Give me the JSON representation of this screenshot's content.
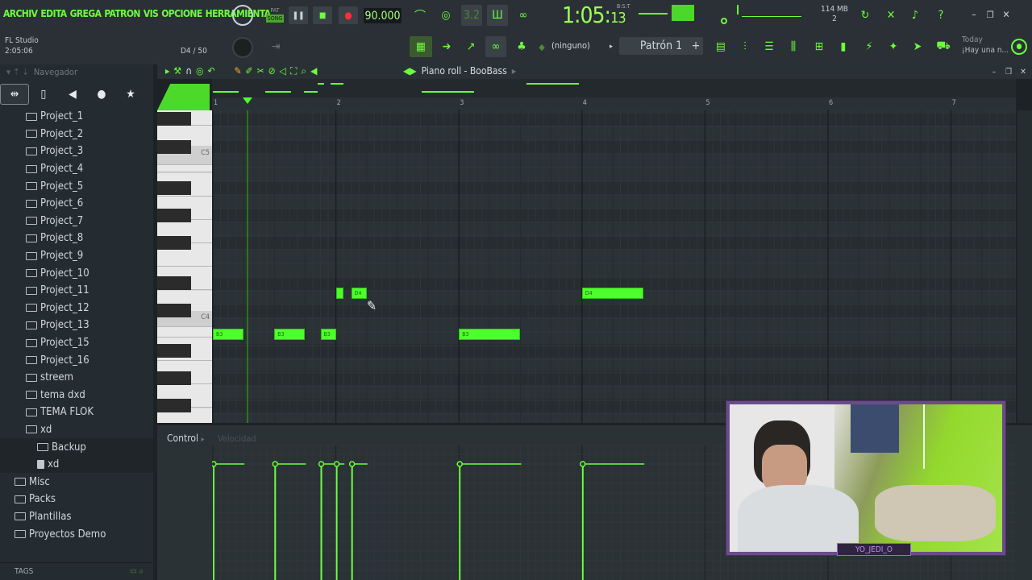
{
  "menu": [
    "ARCHIV",
    "EDITA",
    "GREGA",
    "PATRON",
    "VIS",
    "OPCIONE",
    "HERRAMIENTA"
  ],
  "transport": {
    "pat_label": "PAT",
    "song_label": "SONG",
    "tempo": "90.000"
  },
  "song_time": {
    "main": "1:05:",
    "small": "13",
    "unit": "B:S:T"
  },
  "memory": {
    "value": "114 MB",
    "voices": "2"
  },
  "window_info": {
    "app": "FL Studio",
    "time": "2:05:06",
    "note_info": "D4 / 50"
  },
  "channel": {
    "value": "(ninguno)"
  },
  "pattern": {
    "label": "Patrón 1"
  },
  "hint": {
    "when": "Today",
    "text": "¡Hay una n..."
  },
  "browser": {
    "title": "Navegador",
    "items": [
      {
        "label": "Project_1",
        "type": "folder",
        "depth": 1
      },
      {
        "label": "Project_2",
        "type": "folder",
        "depth": 1
      },
      {
        "label": "Project_3",
        "type": "folder",
        "depth": 1
      },
      {
        "label": "Project_4",
        "type": "folder",
        "depth": 1
      },
      {
        "label": "Project_5",
        "type": "folder",
        "depth": 1
      },
      {
        "label": "Project_6",
        "type": "folder",
        "depth": 1
      },
      {
        "label": "Project_7",
        "type": "folder",
        "depth": 1
      },
      {
        "label": "Project_8",
        "type": "folder",
        "depth": 1
      },
      {
        "label": "Project_9",
        "type": "folder",
        "depth": 1
      },
      {
        "label": "Project_10",
        "type": "folder",
        "depth": 1
      },
      {
        "label": "Project_11",
        "type": "folder",
        "depth": 1
      },
      {
        "label": "Project_12",
        "type": "folder",
        "depth": 1
      },
      {
        "label": "Project_13",
        "type": "folder",
        "depth": 1
      },
      {
        "label": "Project_15",
        "type": "folder",
        "depth": 1
      },
      {
        "label": "Project_16",
        "type": "folder",
        "depth": 1
      },
      {
        "label": "streem",
        "type": "folder",
        "depth": 1
      },
      {
        "label": "tema dxd",
        "type": "folder",
        "depth": 1
      },
      {
        "label": "TEMA FLOK",
        "type": "folder",
        "depth": 1
      },
      {
        "label": "xd",
        "type": "folder",
        "depth": 1
      },
      {
        "label": "Backup",
        "type": "folder",
        "depth": 2
      },
      {
        "label": "xd",
        "type": "file",
        "depth": 2
      },
      {
        "label": "Misc",
        "type": "folder",
        "depth": 0
      },
      {
        "label": "Packs",
        "type": "folder",
        "depth": 0
      },
      {
        "label": "Plantillas",
        "type": "folder",
        "depth": 0
      },
      {
        "label": "Proyectos Demo",
        "type": "folder",
        "depth": 0
      }
    ],
    "tags_label": "TAGS"
  },
  "piano_roll": {
    "title": "Piano roll - BooBass",
    "bar_numbers": [
      "1",
      "2",
      "3",
      "4",
      "5",
      "6",
      "7"
    ],
    "key_labels": {
      "c5": "C5",
      "c4": "C4"
    },
    "notes": [
      {
        "pitch": "B3",
        "start_bar": 1.0,
        "length_bars": 0.25
      },
      {
        "pitch": "B3",
        "start_bar": 1.5,
        "length_bars": 0.25
      },
      {
        "pitch": "B3",
        "start_bar": 1.875,
        "length_bars": 0.125
      },
      {
        "pitch": "D4",
        "start_bar": 2.0,
        "length_bars": 0.0625
      },
      {
        "pitch": "D4",
        "start_bar": 2.125,
        "length_bars": 0.125
      },
      {
        "pitch": "B3",
        "start_bar": 3.0,
        "length_bars": 0.5
      },
      {
        "pitch": "D4",
        "start_bar": 4.0,
        "length_bars": 0.5
      }
    ]
  },
  "control": {
    "label": "Control",
    "param": "Velocidad"
  },
  "webcam": {
    "tag": "YO_JEDI_O"
  },
  "colors": {
    "accent": "#6cff3c",
    "note": "#4eff2e",
    "bg": "#2b3236"
  }
}
